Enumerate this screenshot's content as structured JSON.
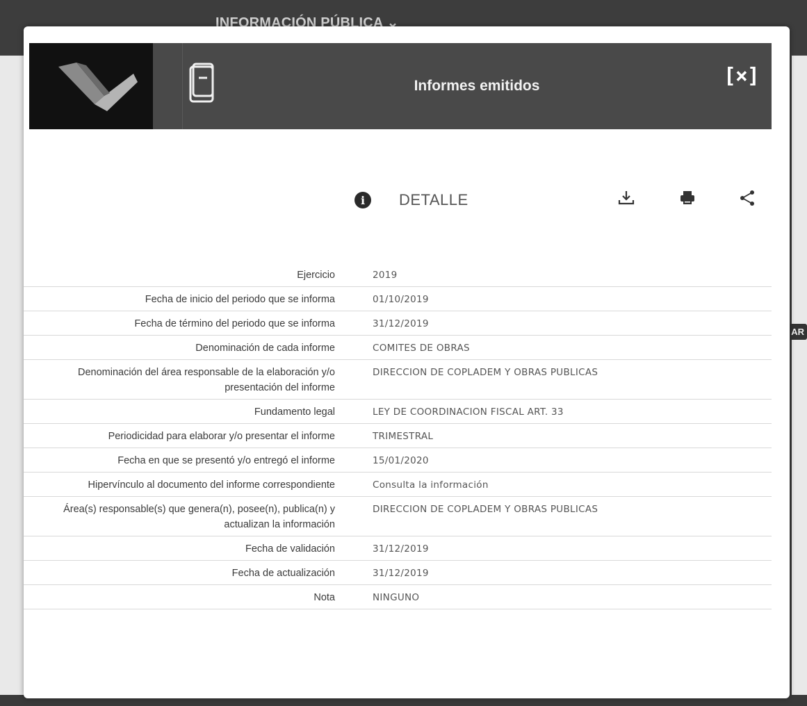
{
  "background": {
    "nav_label": "INFORMACIÓN PÚBLICA ⌄",
    "right_chip": "AR"
  },
  "modal": {
    "title": "Informes emitidos",
    "close_label": "[×]",
    "logo_icon": "brand-logo-icon",
    "doc_icon": "document-icon"
  },
  "detail": {
    "label": "DETALLE",
    "info_icon": "info-icon",
    "tools": [
      "download-icon",
      "print-icon",
      "share-icon"
    ]
  },
  "rows": [
    {
      "label": "Ejercicio",
      "value": "2019"
    },
    {
      "label": "Fecha de inicio del periodo que se informa",
      "value": "01/10/2019"
    },
    {
      "label": "Fecha de término del periodo que se informa",
      "value": "31/12/2019"
    },
    {
      "label": "Denominación de cada informe",
      "value": "COMITES DE OBRAS"
    },
    {
      "label": "Denominación del área responsable de la elaboración y/o presentación del informe",
      "value": "DIRECCION DE COPLADEM Y OBRAS PUBLICAS"
    },
    {
      "label": "Fundamento legal",
      "value": "LEY DE COORDINACION FISCAL ART. 33"
    },
    {
      "label": "Periodicidad para elaborar y/o presentar el informe",
      "value": "TRIMESTRAL"
    },
    {
      "label": "Fecha en que se presentó y/o entregó el informe",
      "value": "15/01/2020"
    },
    {
      "label": "Hipervínculo al documento del informe correspondiente",
      "value": "Consulta la información"
    },
    {
      "label": "Área(s) responsable(s) que genera(n), posee(n), publica(n) y actualizan la información",
      "value": "DIRECCION DE COPLADEM Y OBRAS PUBLICAS"
    },
    {
      "label": "Fecha de validación",
      "value": "31/12/2019"
    },
    {
      "label": "Fecha de actualización",
      "value": "31/12/2019"
    },
    {
      "label": "Nota",
      "value": "NINGUNO"
    }
  ]
}
